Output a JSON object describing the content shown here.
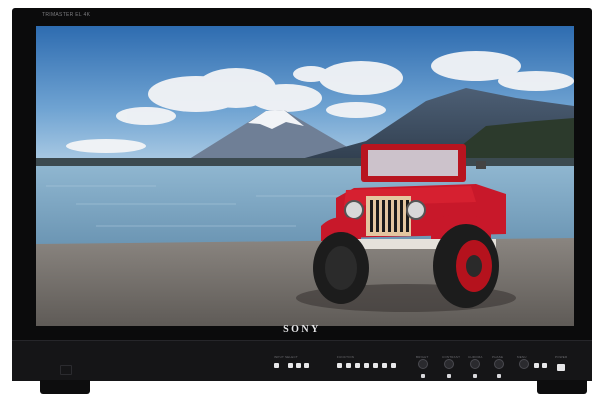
{
  "monitor": {
    "model_label": "TRIMASTER EL 4K",
    "brand": "SONY"
  },
  "control_panel": {
    "groups": [
      {
        "label": "INPUT SELECT"
      },
      {
        "label": "FUNCTION"
      },
      {
        "label": "BRIGHT"
      },
      {
        "label": "CONTRAST"
      },
      {
        "label": "CHROMA"
      },
      {
        "label": "PHASE"
      },
      {
        "label": "MENU"
      },
      {
        "label": "POWER"
      }
    ]
  },
  "colors": {
    "bezel": "#0b0b0c",
    "panel": "#151517",
    "sky_top": "#2f6fb3",
    "water": "#7fa9c7",
    "jeep_red": "#c8182a"
  }
}
